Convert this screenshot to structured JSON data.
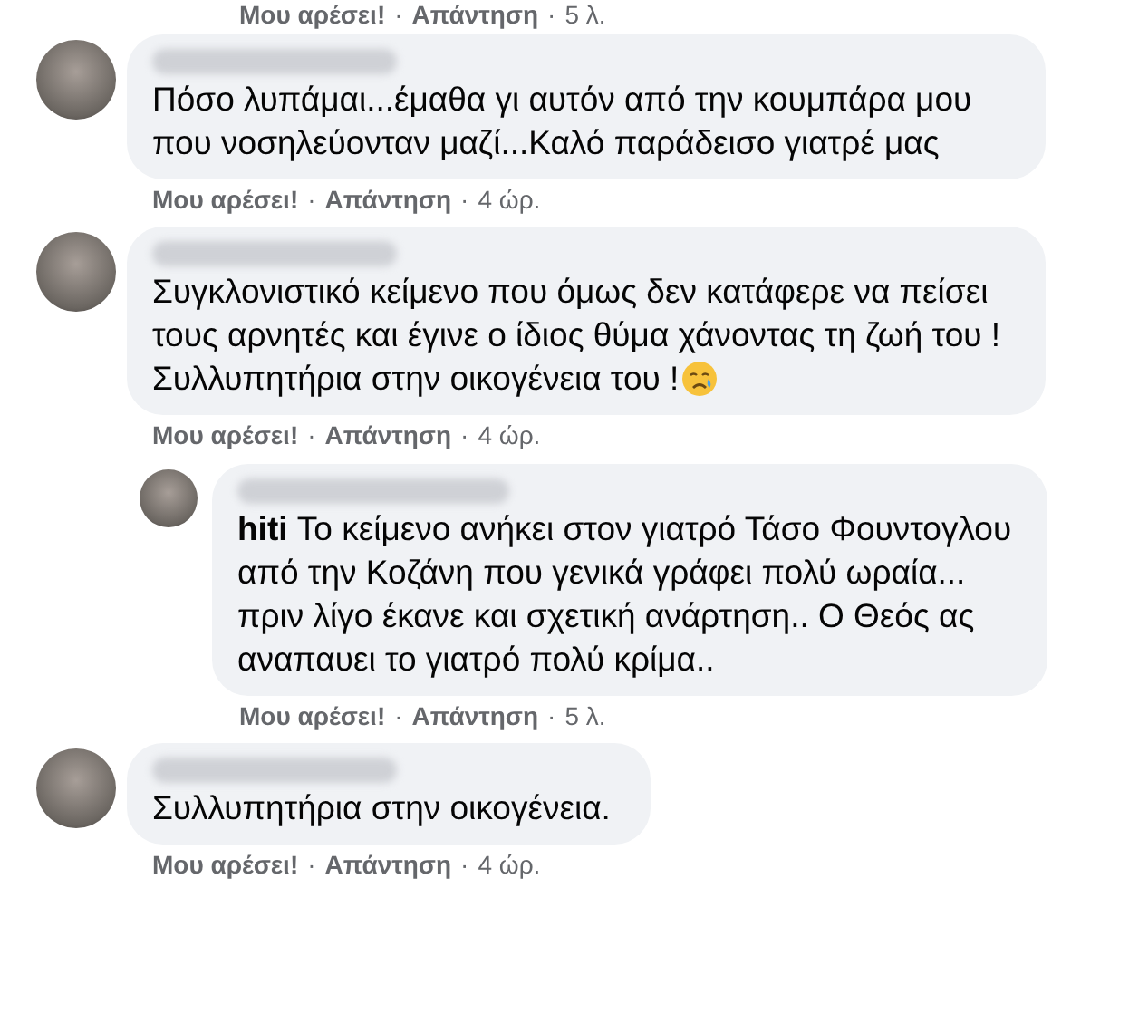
{
  "top_actions": [
    {
      "kind": "link",
      "text": "Μου αρέσει!"
    },
    {
      "kind": "dot",
      "text": "·"
    },
    {
      "kind": "link",
      "text": "Απάντηση"
    },
    {
      "kind": "dot",
      "text": "·"
    },
    {
      "kind": "time",
      "text": "5 λ."
    }
  ],
  "comments": [
    {
      "kind": "comment",
      "body": "Πόσο λυπάμαι...έμαθα γι αυτόν από την κουμπάρα μου που νοσηλεύονταν μαζί...Καλό παράδεισο γιατρέ μας",
      "actions": [
        {
          "kind": "link",
          "text": "Μου αρέσει!"
        },
        {
          "kind": "dot",
          "text": "·"
        },
        {
          "kind": "link",
          "text": "Απάντηση"
        },
        {
          "kind": "dot",
          "text": "·"
        },
        {
          "kind": "time",
          "text": "4 ώρ."
        }
      ]
    },
    {
      "kind": "comment",
      "body": "Συγκλονιστικό κείμενο που όμως δεν κατάφερε να πείσει τους αρνητές και έγινε ο ίδιος θύμα χάνοντας τη ζωή του ! Συλλυπητήρια στην οικογένεια του !",
      "emoji": true,
      "actions": [
        {
          "kind": "link",
          "text": "Μου αρέσει!"
        },
        {
          "kind": "dot",
          "text": "·"
        },
        {
          "kind": "link",
          "text": "Απάντηση"
        },
        {
          "kind": "dot",
          "text": "·"
        },
        {
          "kind": "time",
          "text": "4 ώρ."
        }
      ]
    },
    {
      "kind": "reply",
      "body": "Το κείμενο ανήκει στον γιατρό Τάσο Φουντογλου από την Κοζάνη που γενικά γράφει πολύ ωραία... πριν λίγο έκανε και σχετική ανάρτηση.. Ο Θεός ας αναπαυει το γιατρό πολύ κρίμα..",
      "mention": "hiti",
      "actions": [
        {
          "kind": "link",
          "text": "Μου αρέσει!"
        },
        {
          "kind": "dot",
          "text": "·"
        },
        {
          "kind": "link",
          "text": "Απάντηση"
        },
        {
          "kind": "dot",
          "text": "·"
        },
        {
          "kind": "time",
          "text": "5 λ."
        }
      ]
    },
    {
      "kind": "comment",
      "body": "Συλλυπητήρια στην οικογένεια.",
      "actions": [
        {
          "kind": "link",
          "text": "Μου αρέσει!"
        },
        {
          "kind": "dot",
          "text": "·"
        },
        {
          "kind": "link",
          "text": "Απάντηση"
        },
        {
          "kind": "dot",
          "text": "·"
        },
        {
          "kind": "time",
          "text": "4 ώρ."
        }
      ]
    }
  ]
}
